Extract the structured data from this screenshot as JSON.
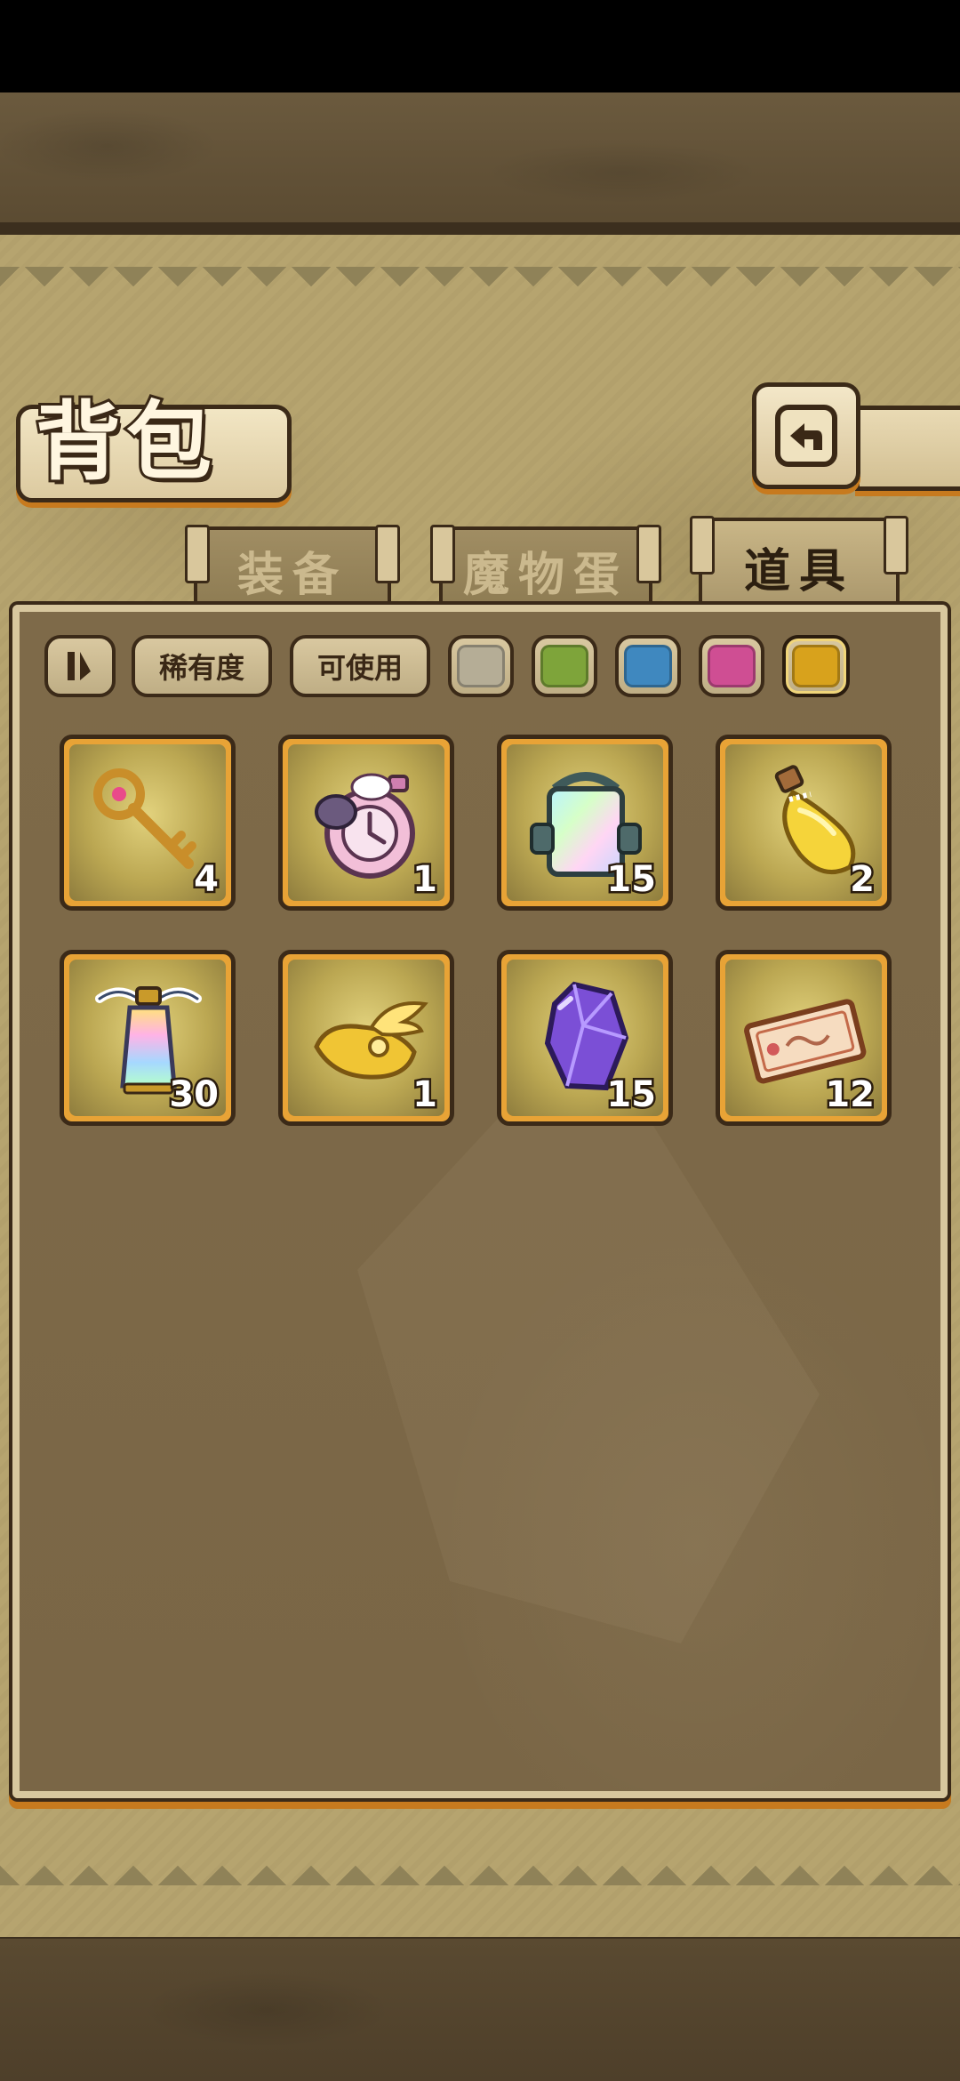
{
  "header": {
    "title": "背包"
  },
  "back_button": {
    "icon": "back-arrow-icon"
  },
  "tabs": [
    {
      "label": "装备",
      "active": false
    },
    {
      "label": "魔物蛋",
      "active": false
    },
    {
      "label": "道具",
      "active": true
    }
  ],
  "filters": {
    "sort_icon": "sort-toggle-icon",
    "rarity_label": "稀有度",
    "usable_label": "可使用",
    "rarity_colors": [
      "#b5ad96",
      "#7ea43a",
      "#3f88bf",
      "#cf4e93",
      "#d8a21c"
    ]
  },
  "items": [
    {
      "name": "golden-key",
      "quantity": "4"
    },
    {
      "name": "pocket-watch",
      "quantity": "1"
    },
    {
      "name": "rainbow-crystal-lantern",
      "quantity": "15"
    },
    {
      "name": "yellow-potion",
      "quantity": "2"
    },
    {
      "name": "winged-lantern",
      "quantity": "30"
    },
    {
      "name": "golden-wing-helmet",
      "quantity": "1"
    },
    {
      "name": "purple-crystal",
      "quantity": "15"
    },
    {
      "name": "ticket",
      "quantity": "12"
    }
  ]
}
